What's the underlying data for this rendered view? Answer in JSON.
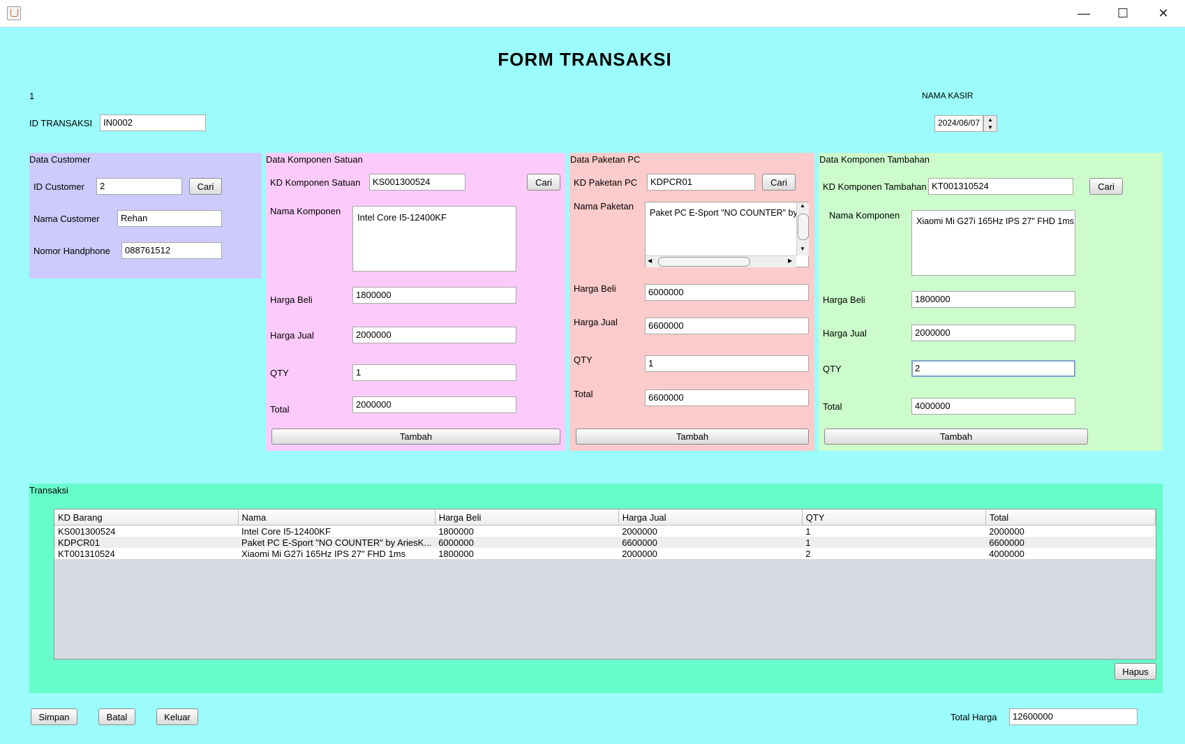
{
  "window": {
    "minimize_icon": "minimize-icon",
    "maximize_icon": "maximize-icon",
    "close_icon": "close-icon"
  },
  "heading": "FORM TRANSAKSI",
  "top": {
    "counter": "1",
    "nama_kasir_label": "NAMA KASIR",
    "id_transaksi_label": "ID TRANSAKSI",
    "id_transaksi_value": "IN0002",
    "date_value": "2024/06/07"
  },
  "customer": {
    "title": "Data Customer",
    "id_label": "ID Customer",
    "id_value": "2",
    "cari_label": "Cari",
    "nama_label": "Nama Customer",
    "nama_value": "Rehan",
    "hp_label": "Nomor Handphone",
    "hp_value": "088761512"
  },
  "satuan": {
    "title": "Data Komponen Satuan",
    "kd_label": "KD Komponen Satuan",
    "kd_value": "KS001300524",
    "cari_label": "Cari",
    "nama_label": "Nama Komponen",
    "nama_value": "Intel Core I5-12400KF",
    "beli_label": "Harga Beli",
    "beli_value": "1800000",
    "jual_label": "Harga Jual",
    "jual_value": "2000000",
    "qty_label": "QTY",
    "qty_value": "1",
    "total_label": "Total",
    "total_value": "2000000",
    "tambah_label": "Tambah"
  },
  "paket": {
    "title": "Data Paketan PC",
    "kd_label": "KD Paketan PC",
    "kd_value": "KDPCR01",
    "cari_label": "Cari",
    "nama_label": "Nama Paketan",
    "nama_value": "Paket PC E-Sport \"NO COUNTER\" by AriesKomputer",
    "beli_label": "Harga Beli",
    "beli_value": "6000000",
    "jual_label": "Harga Jual",
    "jual_value": "6600000",
    "qty_label": "QTY",
    "qty_value": "1",
    "total_label": "Total",
    "total_value": "6600000",
    "tambah_label": "Tambah"
  },
  "tambahan": {
    "title": "Data Komponen Tambahan",
    "kd_label": "KD Komponen Tambahan",
    "kd_value": "KT001310524",
    "cari_label": "Cari",
    "nama_label": "Nama Komponen",
    "nama_value": "Xiaomi Mi G27i 165Hz IPS 27\" FHD 1ms",
    "beli_label": "Harga Beli",
    "beli_value": "1800000",
    "jual_label": "Harga Jual",
    "jual_value": "2000000",
    "qty_label": "QTY",
    "qty_value": "2",
    "total_label": "Total",
    "total_value": "4000000",
    "tambah_label": "Tambah"
  },
  "transaksi": {
    "title": "Transaksi",
    "columns": [
      "KD Barang",
      "Nama",
      "Harga Beli",
      "Harga Jual",
      "QTY",
      "Total"
    ],
    "rows": [
      [
        "KS001300524",
        "Intel Core I5-12400KF",
        "1800000",
        "2000000",
        "1",
        "2000000"
      ],
      [
        "KDPCR01",
        "Paket PC E-Sport \"NO COUNTER\" by AriesK...",
        "6000000",
        "6600000",
        "1",
        "6600000"
      ],
      [
        "KT001310524",
        "Xiaomi Mi G27i 165Hz IPS 27\" FHD 1ms",
        "1800000",
        "2000000",
        "2",
        "4000000"
      ]
    ],
    "hapus_label": "Hapus"
  },
  "bottom": {
    "simpan_label": "Simpan",
    "batal_label": "Batal",
    "keluar_label": "Keluar",
    "total_harga_label": "Total Harga",
    "total_harga_value": "12600000"
  },
  "colors": {
    "background": "#9cfcfc",
    "customer_panel": "#cccbfb",
    "satuan_panel": "#fccbfb",
    "paket_panel": "#fccbcb",
    "tambahan_panel": "#ccfccb",
    "transaksi_panel": "#67fccb"
  }
}
